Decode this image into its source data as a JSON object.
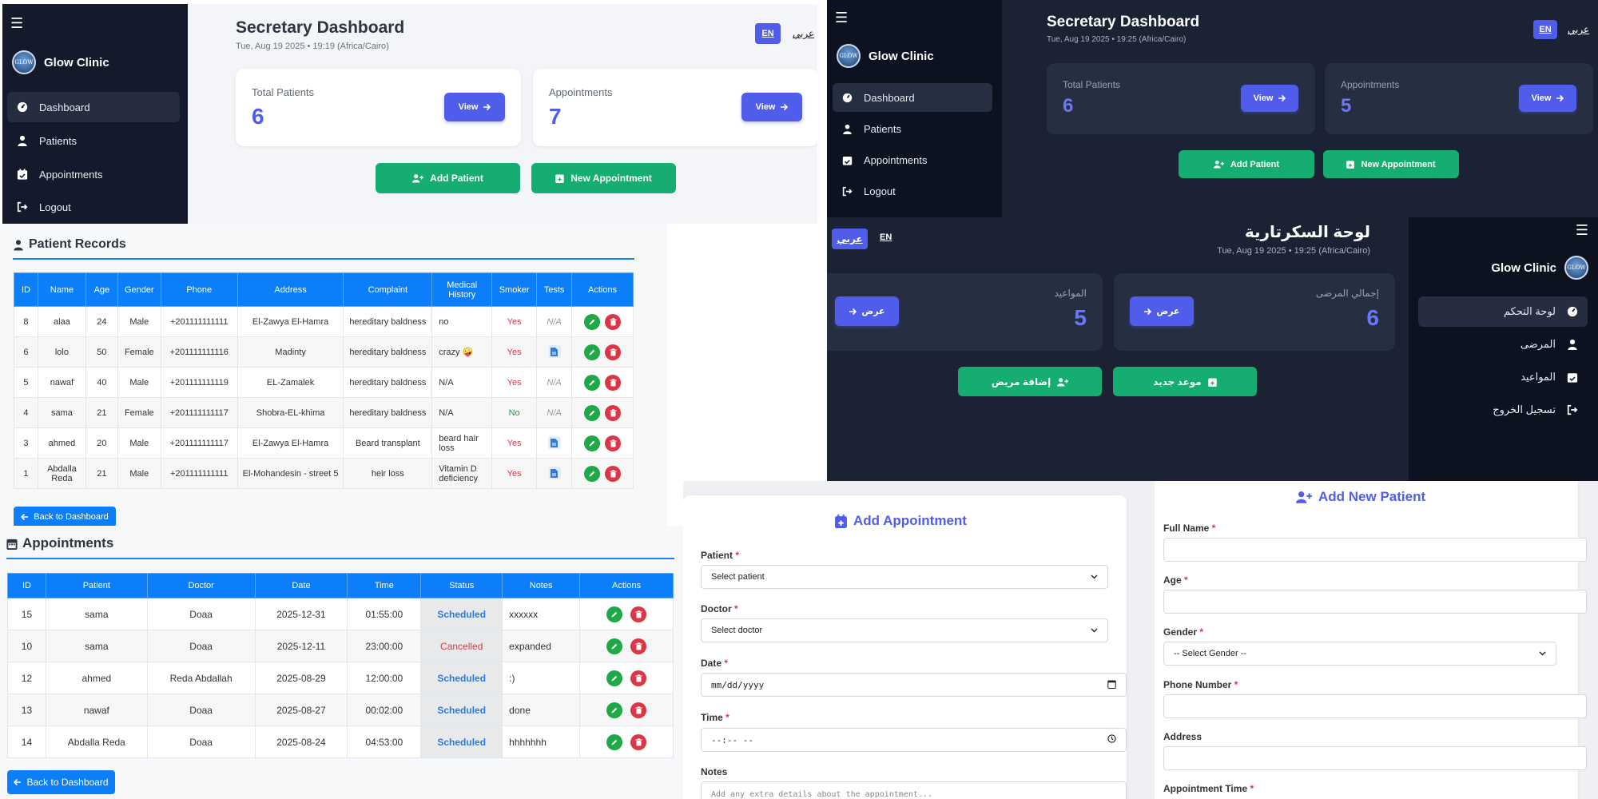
{
  "colors": {
    "primary": "#4f5dea",
    "green": "#16ad73",
    "table_header": "#0d7ef9",
    "danger": "#dc3545",
    "sidebar_dark": "#141a2b"
  },
  "dashboard_light": {
    "menu_icon": "☰",
    "brand": "Glow Clinic",
    "logo_text": "GLOW",
    "nav": [
      {
        "label": "Dashboard",
        "icon": "gauge-icon"
      },
      {
        "label": "Patients",
        "icon": "user-doctor-icon"
      },
      {
        "label": "Appointments",
        "icon": "calendar-check-icon"
      },
      {
        "label": "Logout",
        "icon": "logout-icon"
      }
    ],
    "title": "Secretary Dashboard",
    "date": "Tue, Aug 19 2025 • 19:19 (Africa/Cairo)",
    "lang_en": "EN",
    "lang_ar": "عربي",
    "cards": [
      {
        "label": "Total Patients",
        "value": "6",
        "button": "View"
      },
      {
        "label": "Appointments",
        "value": "7",
        "button": "View"
      }
    ],
    "add_patient": "Add Patient",
    "new_appointment": "New Appointment"
  },
  "dashboard_dark": {
    "menu_icon": "☰",
    "brand": "Glow Clinic",
    "logo_text": "GLOW",
    "nav": [
      {
        "label": "Dashboard"
      },
      {
        "label": "Patients"
      },
      {
        "label": "Appointments"
      },
      {
        "label": "Logout"
      }
    ],
    "title": "Secretary Dashboard",
    "date": "Tue, Aug 19 2025 • 19:25 (Africa/Cairo)",
    "lang_en": "EN",
    "lang_ar": "عربي",
    "cards": [
      {
        "label": "Total Patients",
        "value": "6",
        "button": "View"
      },
      {
        "label": "Appointments",
        "value": "5",
        "button": "View"
      }
    ],
    "add_patient": "Add Patient",
    "new_appointment": "New Appointment"
  },
  "dashboard_arabic": {
    "menu_icon": "☰",
    "brand": "Glow Clinic",
    "logo_text": "GLOW",
    "nav": [
      {
        "label": "لوحة التحكم"
      },
      {
        "label": "المرضى"
      },
      {
        "label": "المواعيد"
      },
      {
        "label": "تسجيل الخروج"
      }
    ],
    "title": "لوحة السكرتارية",
    "date": "Tue, Aug 19 2025 • 19:25 (Africa/Cairo)",
    "lang_ar": "عربي",
    "lang_en": "EN",
    "cards": [
      {
        "label": "إجمالي المرضى",
        "value": "6",
        "button": "عرض"
      },
      {
        "label": "المواعيد",
        "value": "5",
        "button": "عرض"
      }
    ],
    "add_patient": "إضافة مريض",
    "new_appointment": "موعد جديد"
  },
  "patient_records": {
    "title": "Patient Records",
    "columns": [
      "ID",
      "Name",
      "Age",
      "Gender",
      "Phone",
      "Address",
      "Complaint",
      "Medical History",
      "Smoker",
      "Tests",
      "Actions"
    ],
    "rows": [
      {
        "id": "8",
        "name": "alaa",
        "age": "24",
        "gender": "Male",
        "phone": "+201111111111",
        "address": "El-Zawya El-Hamra",
        "complaint": "hereditary baldness",
        "history": "no",
        "smoker": "Yes",
        "tests": "N/A"
      },
      {
        "id": "6",
        "name": "lolo",
        "age": "50",
        "gender": "Female",
        "phone": "+201111111116",
        "address": "Madinty",
        "complaint": "hereditary baldness",
        "history": "crazy 🤪",
        "smoker": "Yes",
        "tests": "file"
      },
      {
        "id": "5",
        "name": "nawaf",
        "age": "40",
        "gender": "Male",
        "phone": "+201111111119",
        "address": "EL-Zamalek",
        "complaint": "hereditary baldness",
        "history": "N/A",
        "smoker": "Yes",
        "tests": "N/A"
      },
      {
        "id": "4",
        "name": "sama",
        "age": "21",
        "gender": "Female",
        "phone": "+201111111117",
        "address": "Shobra-EL-khima",
        "complaint": "hereditary baldness",
        "history": "N/A",
        "smoker": "No",
        "tests": "N/A"
      },
      {
        "id": "3",
        "name": "ahmed",
        "age": "20",
        "gender": "Male",
        "phone": "+201111111117",
        "address": "El-Zawya El-Hamra",
        "complaint": "Beard transplant",
        "history": "beard hair loss",
        "smoker": "Yes",
        "tests": "file"
      },
      {
        "id": "1",
        "name": "Abdalla Reda",
        "age": "21",
        "gender": "Male",
        "phone": "+201111111111",
        "address": "El-Mohandesin - street 5",
        "complaint": "heir loss",
        "history": "Vitamin D deficiency",
        "smoker": "Yes",
        "tests": "file"
      }
    ],
    "back_button": "Back to Dashboard"
  },
  "appointments": {
    "title": "Appointments",
    "columns": [
      "ID",
      "Patient",
      "Doctor",
      "Date",
      "Time",
      "Status",
      "Notes",
      "Actions"
    ],
    "rows": [
      {
        "id": "15",
        "patient": "sama",
        "doctor": "Doaa",
        "date": "2025-12-31",
        "time": "01:55:00",
        "status": "Scheduled",
        "notes": "xxxxxx"
      },
      {
        "id": "10",
        "patient": "sama",
        "doctor": "Doaa",
        "date": "2025-12-11",
        "time": "23:00:00",
        "status": "Cancelled",
        "notes": "expanded"
      },
      {
        "id": "12",
        "patient": "ahmed",
        "doctor": "Reda Abdallah",
        "date": "2025-08-29",
        "time": "12:00:00",
        "status": "Scheduled",
        "notes": ":)"
      },
      {
        "id": "13",
        "patient": "nawaf",
        "doctor": "Doaa",
        "date": "2025-08-27",
        "time": "00:02:00",
        "status": "Scheduled",
        "notes": "done"
      },
      {
        "id": "14",
        "patient": "Abdalla Reda",
        "doctor": "Doaa",
        "date": "2025-08-24",
        "time": "04:53:00",
        "status": "Scheduled",
        "notes": "hhhhhhh"
      }
    ],
    "back_button": "Back to Dashboard"
  },
  "add_appointment": {
    "title": "Add Appointment",
    "patient_label": "Patient",
    "patient_value": "Select patient",
    "doctor_label": "Doctor",
    "doctor_value": "Select doctor",
    "date_label": "Date",
    "date_placeholder": "mm/dd/yyyy",
    "time_label": "Time",
    "time_placeholder": "--:-- --",
    "notes_label": "Notes",
    "notes_placeholder": "Add any extra details about the appointment..."
  },
  "add_patient_form": {
    "title": "Add New Patient",
    "full_name_label": "Full Name",
    "age_label": "Age",
    "gender_label": "Gender",
    "gender_value": "-- Select Gender --",
    "phone_label": "Phone Number",
    "address_label": "Address",
    "appt_time_label": "Appointment Time"
  }
}
